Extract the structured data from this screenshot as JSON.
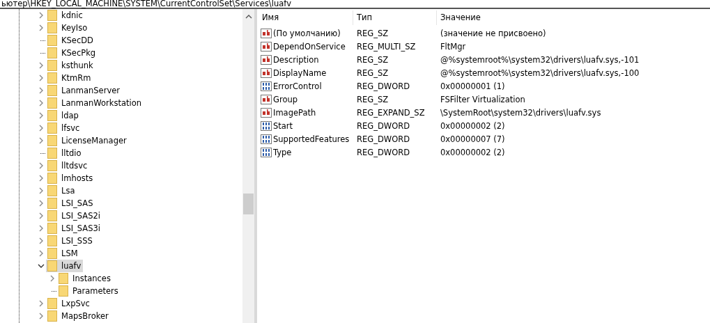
{
  "address_bar": {
    "path": "ьютер\\HKEY_LOCAL_MACHINE\\SYSTEM\\CurrentControlSet\\Services\\luafv"
  },
  "tree": {
    "items": [
      {
        "name": "kdnic",
        "expandable": true,
        "selected": false
      },
      {
        "name": "KeyIso",
        "expandable": true,
        "selected": false
      },
      {
        "name": "KSecDD",
        "expandable": false,
        "selected": false
      },
      {
        "name": "KSecPkg",
        "expandable": false,
        "selected": false
      },
      {
        "name": "ksthunk",
        "expandable": true,
        "selected": false
      },
      {
        "name": "KtmRm",
        "expandable": true,
        "selected": false
      },
      {
        "name": "LanmanServer",
        "expandable": true,
        "selected": false
      },
      {
        "name": "LanmanWorkstation",
        "expandable": true,
        "selected": false
      },
      {
        "name": "ldap",
        "expandable": true,
        "selected": false
      },
      {
        "name": "lfsvc",
        "expandable": true,
        "selected": false
      },
      {
        "name": "LicenseManager",
        "expandable": true,
        "selected": false
      },
      {
        "name": "lltdio",
        "expandable": false,
        "selected": false
      },
      {
        "name": "lltdsvc",
        "expandable": true,
        "selected": false
      },
      {
        "name": "lmhosts",
        "expandable": true,
        "selected": false
      },
      {
        "name": "Lsa",
        "expandable": true,
        "selected": false
      },
      {
        "name": "LSI_SAS",
        "expandable": true,
        "selected": false
      },
      {
        "name": "LSI_SAS2i",
        "expandable": true,
        "selected": false
      },
      {
        "name": "LSI_SAS3i",
        "expandable": true,
        "selected": false
      },
      {
        "name": "LSI_SSS",
        "expandable": true,
        "selected": false
      },
      {
        "name": "LSM",
        "expandable": true,
        "selected": false
      },
      {
        "name": "luafv",
        "expandable": true,
        "expanded": true,
        "selected": true,
        "children": [
          {
            "name": "Instances",
            "expandable": true,
            "selected": false
          },
          {
            "name": "Parameters",
            "expandable": false,
            "selected": false
          }
        ]
      },
      {
        "name": "LxpSvc",
        "expandable": true,
        "selected": false
      },
      {
        "name": "MapsBroker",
        "expandable": true,
        "selected": false
      }
    ]
  },
  "table": {
    "columns": [
      "Имя",
      "Тип",
      "Значение"
    ],
    "rows": [
      {
        "kind": "string",
        "name": "(По умолчанию)",
        "type": "REG_SZ",
        "value": "(значение не присвоено)"
      },
      {
        "kind": "string",
        "name": "DependOnService",
        "type": "REG_MULTI_SZ",
        "value": "FltMgr"
      },
      {
        "kind": "string",
        "name": "Description",
        "type": "REG_SZ",
        "value": "@%systemroot%\\system32\\drivers\\luafv.sys,-101"
      },
      {
        "kind": "string",
        "name": "DisplayName",
        "type": "REG_SZ",
        "value": "@%systemroot%\\system32\\drivers\\luafv.sys,-100"
      },
      {
        "kind": "binary",
        "name": "ErrorControl",
        "type": "REG_DWORD",
        "value": "0x00000001 (1)"
      },
      {
        "kind": "string",
        "name": "Group",
        "type": "REG_SZ",
        "value": "FSFilter Virtualization"
      },
      {
        "kind": "string",
        "name": "ImagePath",
        "type": "REG_EXPAND_SZ",
        "value": "\\SystemRoot\\system32\\drivers\\luafv.sys"
      },
      {
        "kind": "binary",
        "name": "Start",
        "type": "REG_DWORD",
        "value": "0x00000002 (2)"
      },
      {
        "kind": "binary",
        "name": "SupportedFeatures",
        "type": "REG_DWORD",
        "value": "0x00000007 (7)"
      },
      {
        "kind": "binary",
        "name": "Type",
        "type": "REG_DWORD",
        "value": "0x00000002 (2)"
      }
    ]
  }
}
